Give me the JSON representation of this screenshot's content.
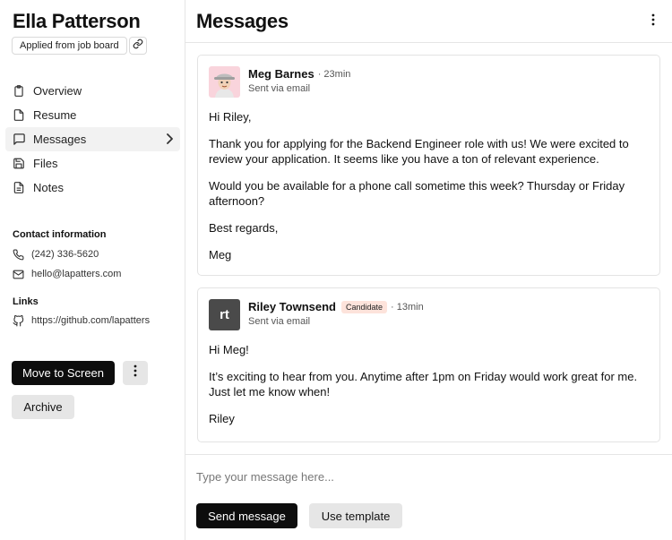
{
  "candidate": {
    "name": "Ella Patterson",
    "source": "Applied from job board"
  },
  "nav": {
    "items": [
      {
        "label": "Overview",
        "icon": "clipboard-icon"
      },
      {
        "label": "Resume",
        "icon": "file-icon"
      },
      {
        "label": "Messages",
        "icon": "message-icon",
        "active": true
      },
      {
        "label": "Files",
        "icon": "save-icon"
      },
      {
        "label": "Notes",
        "icon": "notes-icon"
      }
    ]
  },
  "contact": {
    "title": "Contact information",
    "phone": "(242) 336-5620",
    "email": "hello@lapatters.com"
  },
  "links": {
    "title": "Links",
    "github": "https://github.com/lapatters"
  },
  "actions": {
    "move_label": "Move to Screen",
    "archive_label": "Archive"
  },
  "main": {
    "title": "Messages"
  },
  "messages": [
    {
      "sender": "Meg Barnes",
      "time": "· 23min",
      "via": "Sent via email",
      "paragraphs": [
        "Hi Riley,",
        "Thank you for applying for the Backend Engineer role with us! We were excited to review your application. It seems like you have a ton of relevant experience.",
        "Would you be available for a phone call sometime this week? Thursday or Friday afternoon?",
        "Best regards,",
        "Meg"
      ]
    },
    {
      "sender": "Riley Townsend",
      "initials": "rt",
      "badge": "Candidate",
      "time": "· 13min",
      "via": "Sent via email",
      "paragraphs": [
        "Hi Meg!",
        "It’s exciting to hear from you. Anytime after 1pm on Friday would work great for me. Just let me know when!",
        "Riley"
      ]
    }
  ],
  "composer": {
    "placeholder": "Type your message here...",
    "send_label": "Send message",
    "template_label": "Use template"
  },
  "colors": {
    "primary_button": "#0d0d0d",
    "secondary_button": "#e6e6e6",
    "badge_bg": "#fde3db",
    "avatar_bg": "#f9d4dc"
  }
}
